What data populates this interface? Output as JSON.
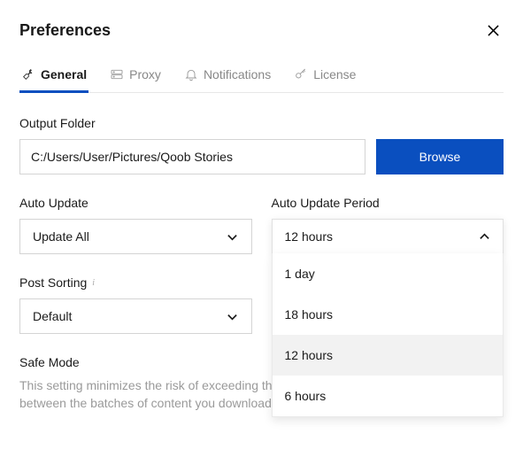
{
  "window": {
    "title": "Preferences"
  },
  "tabs": {
    "general": "General",
    "proxy": "Proxy",
    "notifications": "Notifications",
    "license": "License"
  },
  "output_folder": {
    "label": "Output Folder",
    "value": "C:/Users/User/Pictures/Qoob Stories",
    "browse": "Browse"
  },
  "auto_update": {
    "label": "Auto Update",
    "value": "Update All"
  },
  "auto_update_period": {
    "label": "Auto Update Period",
    "value": "12 hours",
    "options": {
      "o0": "1 day",
      "o1": "18 hours",
      "o2": "12 hours",
      "o3": "6 hours"
    }
  },
  "post_sorting": {
    "label": "Post Sorting",
    "value": "Default"
  },
  "safe_mode": {
    "label": "Safe Mode",
    "description": "This setting minimizes the risk of exceeding the Instagram's limits by adding pauses between the batches of content you download."
  }
}
